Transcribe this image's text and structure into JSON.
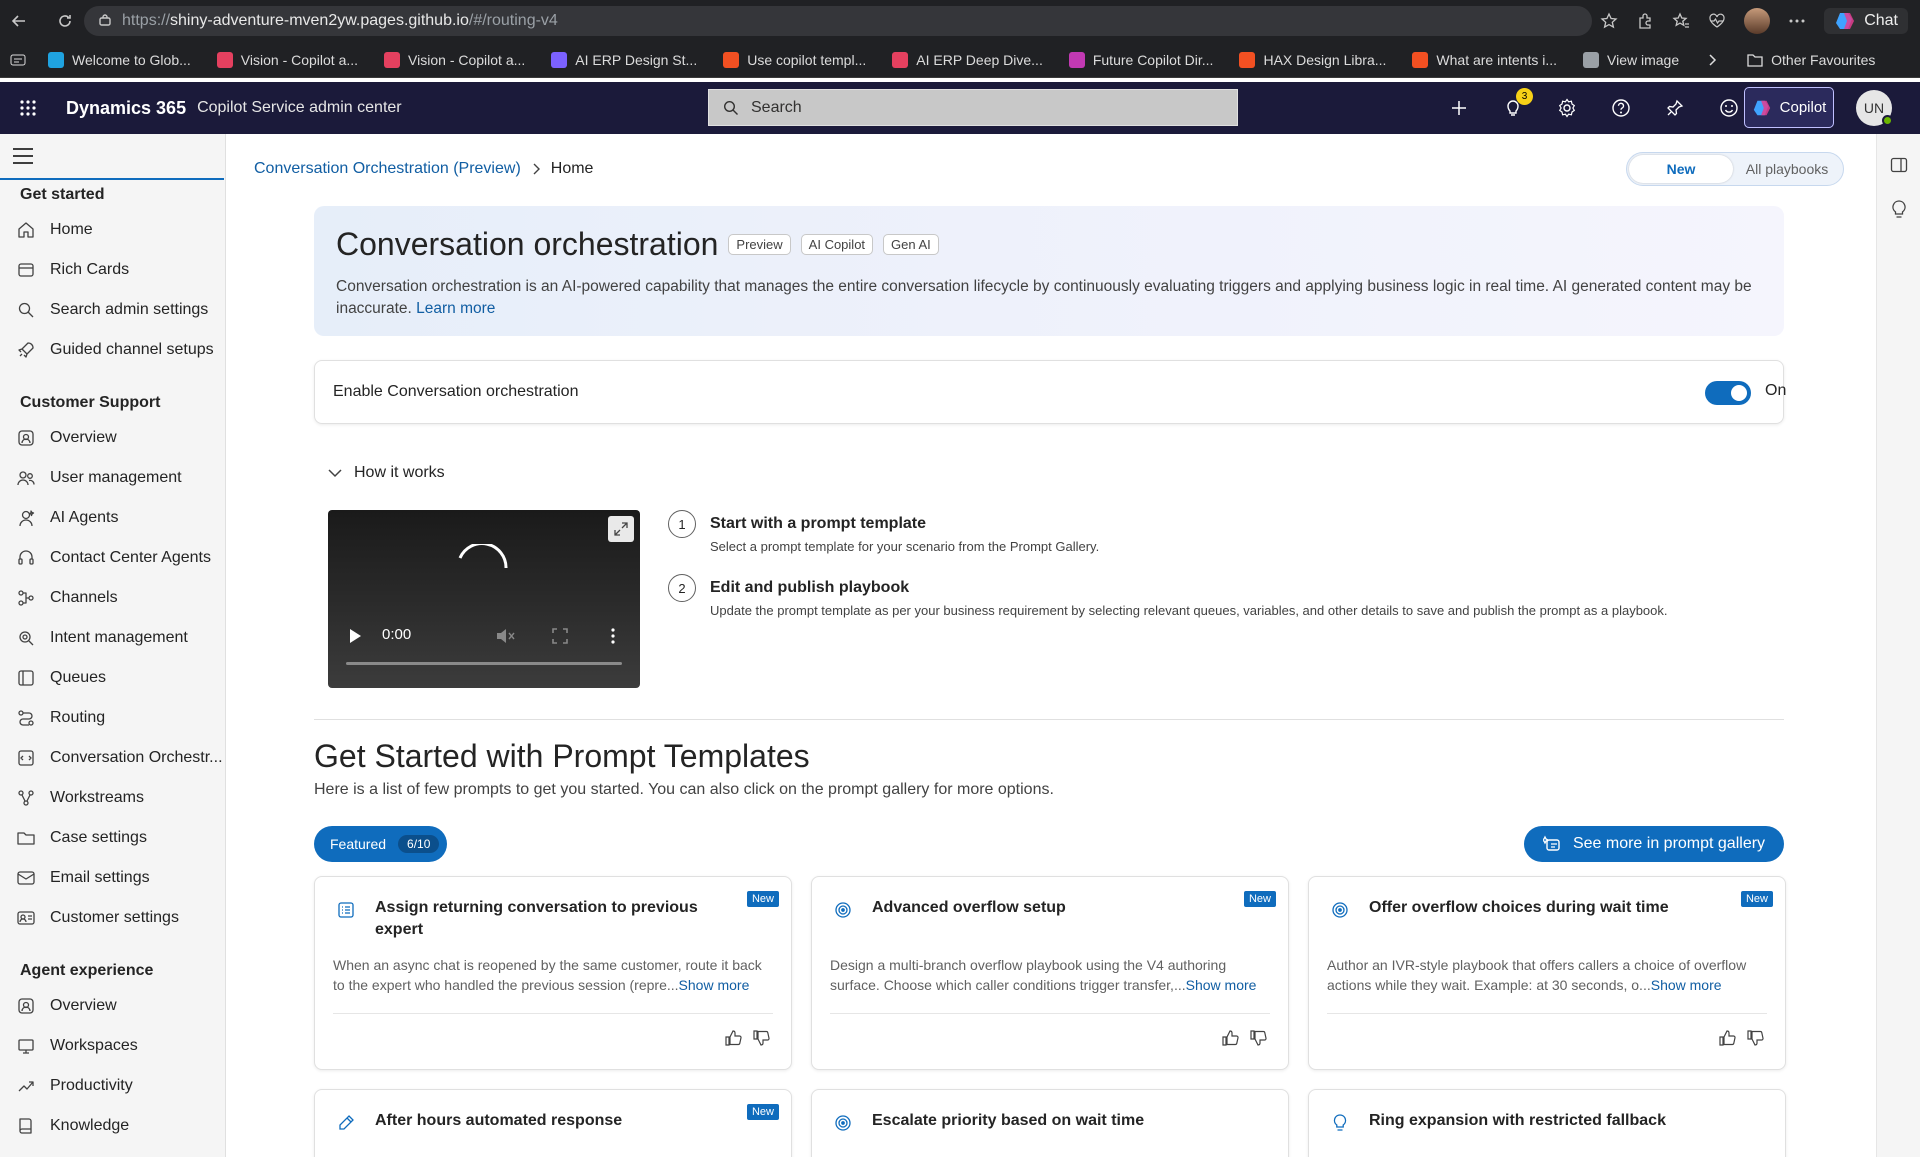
{
  "browser": {
    "url_prefix": "https://",
    "url_host": "shiny-adventure-mven2yw.pages.github.io",
    "url_path": "/#/routing-v4",
    "chat_label": "Chat",
    "favorites": [
      {
        "label": "Welcome to Glob...",
        "color": "#1fa3e0"
      },
      {
        "label": "Vision - Copilot a...",
        "color": "#e4405f"
      },
      {
        "label": "Vision - Copilot a...",
        "color": "#e4405f"
      },
      {
        "label": "AI ERP Design St...",
        "color": "#7b61ff"
      },
      {
        "label": "Use copilot templ...",
        "color": "#f25022"
      },
      {
        "label": "AI ERP Deep Dive...",
        "color": "#e4405f"
      },
      {
        "label": "Future Copilot Dir...",
        "color": "#c239b3"
      },
      {
        "label": "HAX Design Libra...",
        "color": "#f25022"
      },
      {
        "label": "What are intents i...",
        "color": "#f25022"
      },
      {
        "label": "View image",
        "color": "#9aa0a6"
      }
    ],
    "other_favorites": "Other Favourites"
  },
  "app": {
    "brand": "Dynamics 365",
    "name": "Copilot Service admin center",
    "search_placeholder": "Search",
    "notification_count": "3",
    "copilot_label": "Copilot",
    "avatar_initials": "UN"
  },
  "sidebar": {
    "sections": [
      {
        "title": "Get started",
        "items": [
          {
            "label": "Home",
            "icon": "home-icon"
          },
          {
            "label": "Rich Cards",
            "icon": "cards-icon"
          },
          {
            "label": "Search admin settings",
            "icon": "search-icon"
          },
          {
            "label": "Guided channel setups",
            "icon": "rocket-icon"
          }
        ]
      },
      {
        "title": "Customer Support",
        "items": [
          {
            "label": "Overview",
            "icon": "overview-icon"
          },
          {
            "label": "User management",
            "icon": "people-icon"
          },
          {
            "label": "AI Agents",
            "icon": "agent-icon"
          },
          {
            "label": "Contact Center Agents",
            "icon": "headset-icon"
          },
          {
            "label": "Channels",
            "icon": "channels-icon"
          },
          {
            "label": "Intent management",
            "icon": "intent-icon"
          },
          {
            "label": "Queues",
            "icon": "queue-icon"
          },
          {
            "label": "Routing",
            "icon": "routing-icon"
          },
          {
            "label": "Conversation Orchestr...",
            "icon": "orchestration-icon"
          },
          {
            "label": "Workstreams",
            "icon": "workstream-icon"
          },
          {
            "label": "Case settings",
            "icon": "folder-icon"
          },
          {
            "label": "Email settings",
            "icon": "mail-icon"
          },
          {
            "label": "Customer settings",
            "icon": "contact-card-icon"
          }
        ]
      },
      {
        "title": "Agent experience",
        "items": [
          {
            "label": "Overview",
            "icon": "overview-icon"
          },
          {
            "label": "Workspaces",
            "icon": "workspace-icon"
          },
          {
            "label": "Productivity",
            "icon": "productivity-icon"
          },
          {
            "label": "Knowledge",
            "icon": "book-icon"
          }
        ]
      }
    ]
  },
  "main": {
    "breadcrumb": {
      "parent": "Conversation Orchestration (Preview)",
      "current": "Home"
    },
    "toggle_group": {
      "active": "New",
      "inactive": "All playbooks"
    },
    "banner": {
      "title": "Conversation orchestration",
      "tags": [
        "Preview",
        "AI Copilot",
        "Gen AI"
      ],
      "description": "Conversation orchestration is an AI-powered capability that manages the entire conversation lifecycle by continuously evaluating triggers and applying business logic in real time. AI generated content may be inaccurate.",
      "learn_more": "Learn more"
    },
    "enable": {
      "label": "Enable Conversation orchestration",
      "state": "On"
    },
    "how_it_works": {
      "title": "How it works",
      "video_time": "0:00",
      "steps": [
        {
          "num": "1",
          "title": "Start with a prompt template",
          "desc": "Select a prompt template for your scenario from the Prompt Gallery."
        },
        {
          "num": "2",
          "title": "Edit and publish playbook",
          "desc": "Update the prompt template as per your business requirement by selecting relevant queues, variables, and other details to save and publish the prompt as a playbook."
        }
      ]
    },
    "templates": {
      "title": "Get Started with Prompt Templates",
      "subtitle": "Here is a list of few prompts to get you started. You can also click on the prompt gallery for more options.",
      "featured_label": "Featured",
      "featured_count": "6/10",
      "gallery_button": "See more in prompt gallery",
      "new_badge": "New",
      "show_more": "Show more",
      "cards": [
        {
          "title": "Assign returning conversation to previous expert",
          "desc": "When an async chat is reopened by the same customer, route it back to the expert who handled the previous session (repre...",
          "new": true,
          "icon": "list-icon"
        },
        {
          "title": "Advanced overflow setup",
          "desc": "Design a multi-branch overflow playbook using the V4 authoring surface. Choose which caller conditions trigger transfer,...",
          "new": true,
          "icon": "target-icon"
        },
        {
          "title": "Offer overflow choices during wait time",
          "desc": "Author an IVR-style playbook that offers callers a choice of overflow actions while they wait. Example: at 30 seconds, o...",
          "new": true,
          "icon": "target-icon"
        },
        {
          "title": "After hours automated response",
          "desc": "",
          "new": true,
          "icon": "pencil-icon"
        },
        {
          "title": "Escalate priority based on wait time",
          "desc": "",
          "new": false,
          "icon": "target-icon"
        },
        {
          "title": "Ring expansion with restricted fallback",
          "desc": "",
          "new": false,
          "icon": "bulb-icon"
        }
      ]
    }
  }
}
